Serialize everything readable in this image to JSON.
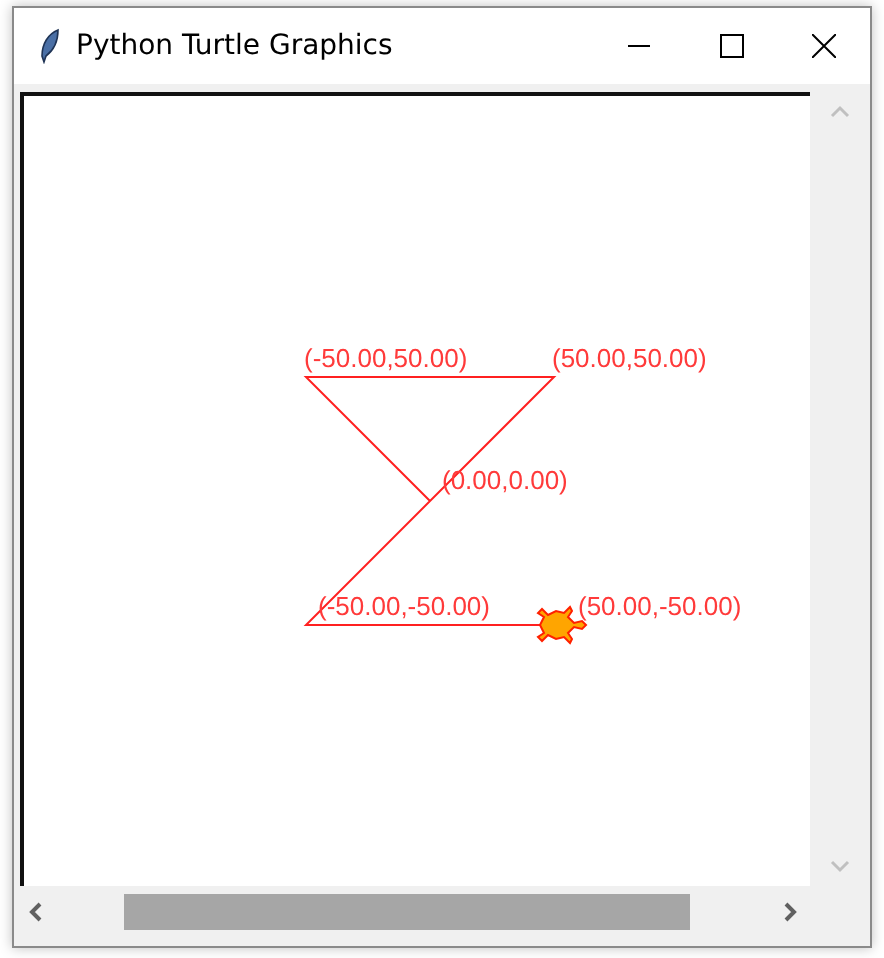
{
  "window": {
    "title": "Python Turtle Graphics"
  },
  "canvas": {
    "labels": [
      "(-50.00,50.00)",
      "(50.00,50.00)",
      "(0.00,0.00)",
      "(-50.00,-50.00)",
      "(50.00,-50.00)"
    ]
  }
}
